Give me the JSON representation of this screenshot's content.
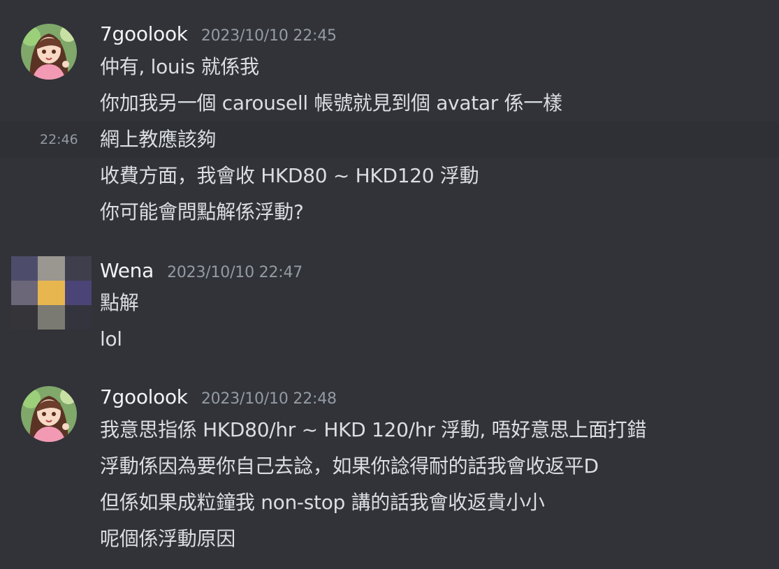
{
  "messages": [
    {
      "author": "7goolook",
      "timestamp": "2023/10/10 22:45",
      "lines": [
        "仲有, louis 就係我",
        "你加我另一個 carousell 帳號就見到個 avatar 係一樣",
        "網上教應該夠",
        "收費方面，我會收 HKD80 ~ HKD120 浮動",
        "你可能會問點解係浮動?"
      ],
      "hover_time": "22:46"
    },
    {
      "author": "Wena",
      "timestamp": "2023/10/10 22:47",
      "lines": [
        "點解",
        "lol"
      ]
    },
    {
      "author": "7goolook",
      "timestamp": "2023/10/10 22:48",
      "lines": [
        "我意思指係 HKD80/hr ~ HKD 120/hr 浮動, 唔好意思上面打錯",
        "浮動係因為要你自己去諗，如果你諗得耐的話我會收返平D",
        "但係如果成粒鐘我 non-stop 講的話我會收返貴小小",
        "呢個係浮動原因"
      ]
    }
  ],
  "colors": {
    "background": "#313338",
    "hover_row": "#2e3035",
    "username": "#f2f3f5",
    "message_text": "#dbdee1",
    "timestamp": "#949ba4"
  },
  "icons": {
    "avatar_7goolook": "anime-girl-avatar-icon",
    "avatar_wena": "pixelated-avatar-icon"
  }
}
